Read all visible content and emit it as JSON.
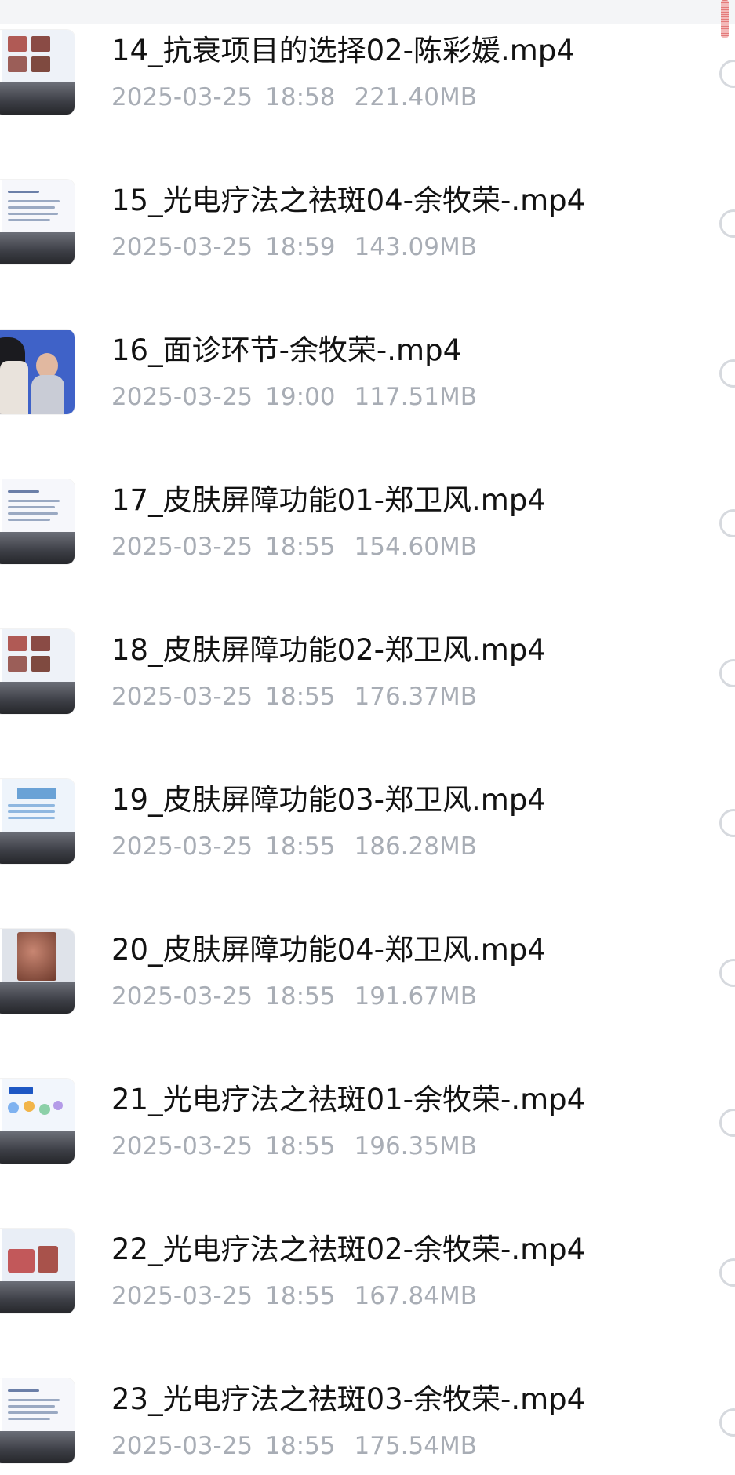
{
  "files": [
    {
      "name": "14_抗衰项目的选择02-陈彩媛.mp4",
      "date": "2025-03-25",
      "time": "18:58",
      "size": "221.40MB",
      "thumb": "slide-photos"
    },
    {
      "name": "15_光电疗法之祛斑04-余牧荣-.mp4",
      "date": "2025-03-25",
      "time": "18:59",
      "size": "143.09MB",
      "thumb": "slide-text"
    },
    {
      "name": "16_面诊环节-余牧荣-.mp4",
      "date": "2025-03-25",
      "time": "19:00",
      "size": "117.51MB",
      "thumb": "stage-people"
    },
    {
      "name": "17_皮肤屏障功能01-郑卫风.mp4",
      "date": "2025-03-25",
      "time": "18:55",
      "size": "154.60MB",
      "thumb": "slide-text"
    },
    {
      "name": "18_皮肤屏障功能02-郑卫风.mp4",
      "date": "2025-03-25",
      "time": "18:55",
      "size": "176.37MB",
      "thumb": "slide-photos"
    },
    {
      "name": "19_皮肤屏障功能03-郑卫风.mp4",
      "date": "2025-03-25",
      "time": "18:55",
      "size": "186.28MB",
      "thumb": "slide-table"
    },
    {
      "name": "20_皮肤屏障功能04-郑卫风.mp4",
      "date": "2025-03-25",
      "time": "18:55",
      "size": "191.67MB",
      "thumb": "skin-closeup"
    },
    {
      "name": "21_光电疗法之祛斑01-余牧荣-.mp4",
      "date": "2025-03-25",
      "time": "18:55",
      "size": "196.35MB",
      "thumb": "slide-diagram"
    },
    {
      "name": "22_光电疗法之祛斑02-余牧荣-.mp4",
      "date": "2025-03-25",
      "time": "18:55",
      "size": "167.84MB",
      "thumb": "slide-skin"
    },
    {
      "name": "23_光电疗法之祛斑03-余牧荣-.mp4",
      "date": "2025-03-25",
      "time": "18:55",
      "size": "175.54MB",
      "thumb": "slide-text"
    }
  ],
  "colors": {
    "title": "#121212",
    "meta": "#a8adb5",
    "radio_border": "#d6d9de",
    "topbar": "#f4f5f7",
    "scroll_indicator": "#e37a7a"
  },
  "icons": {
    "row_selector": "radio-circle-icon",
    "thumbnail": "video-thumbnail-icon"
  }
}
